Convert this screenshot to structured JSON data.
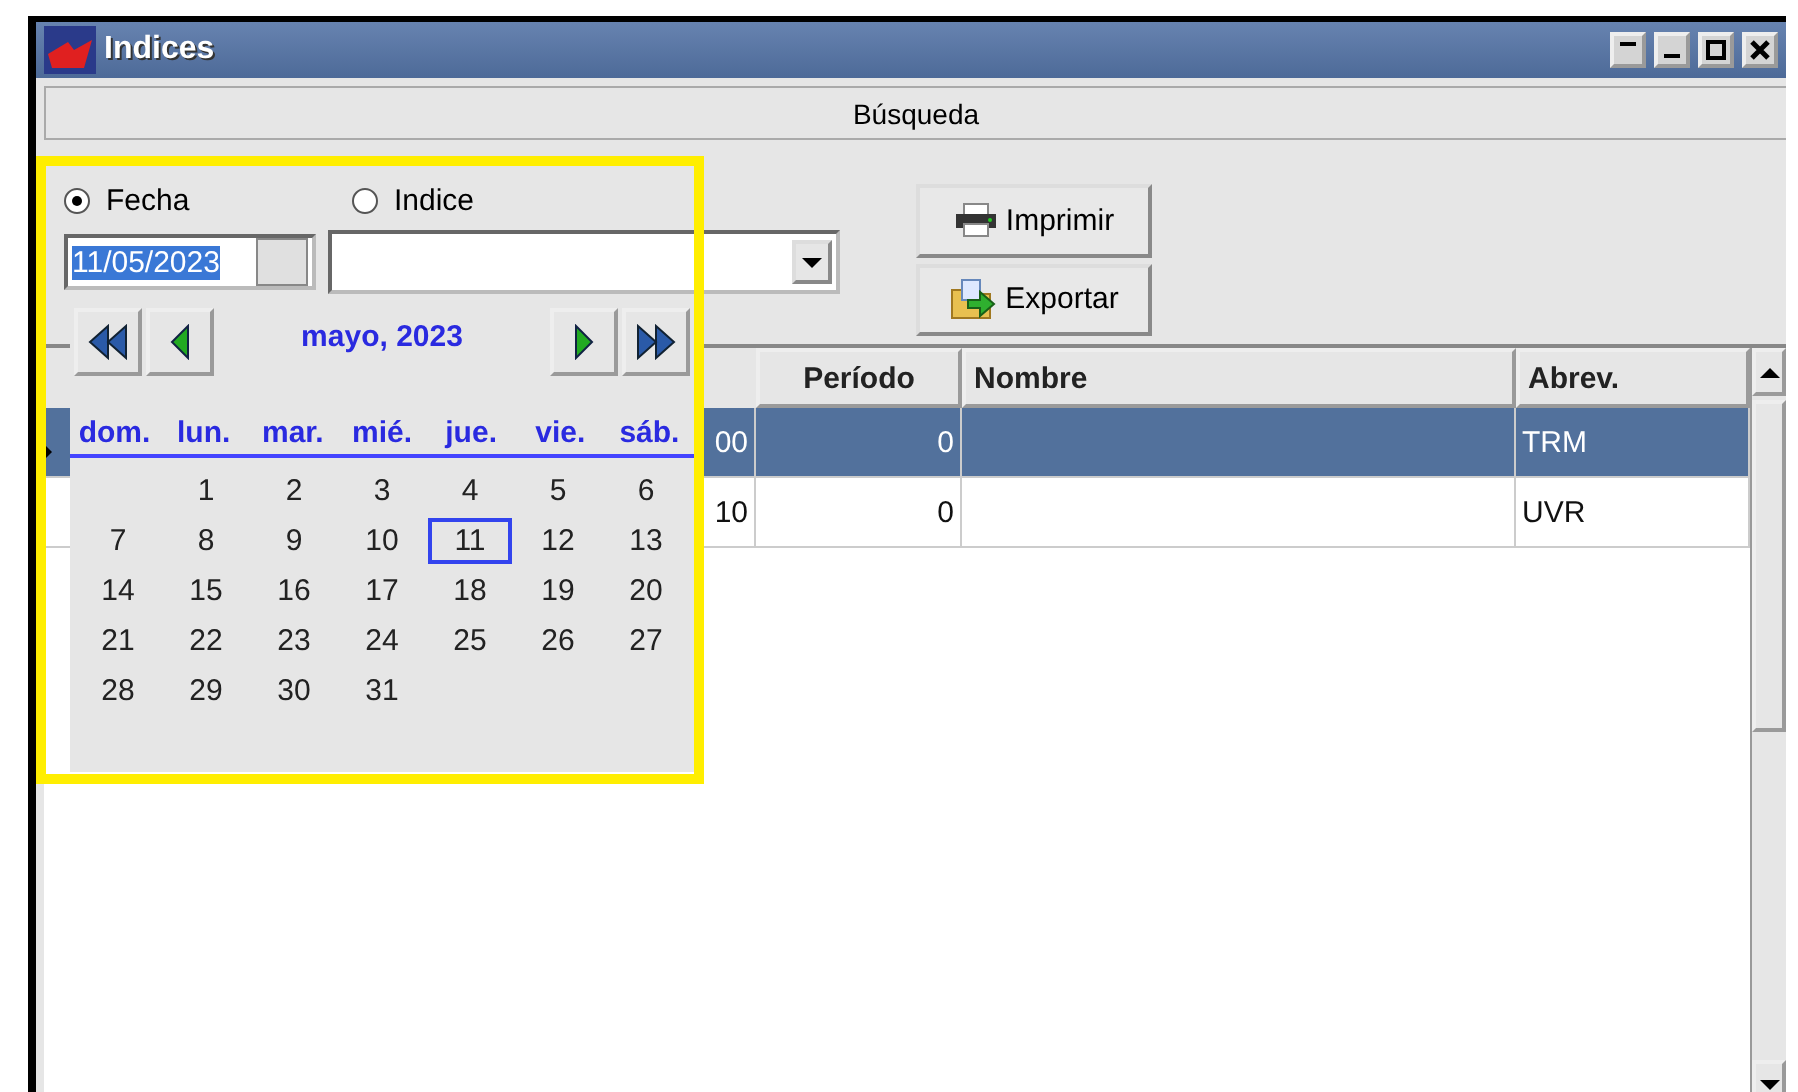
{
  "window": {
    "title": "Indices"
  },
  "section_title": "Búsqueda",
  "search_mode": [
    {
      "label": "Fecha",
      "selected": true
    },
    {
      "label": "Indice",
      "selected": false
    }
  ],
  "date_field": {
    "value": "11/05/2023"
  },
  "buttons": [
    {
      "label": "Imprimir",
      "kind": "print"
    },
    {
      "label": "Exportar",
      "kind": "export"
    }
  ],
  "table": {
    "columns": [
      "Período",
      "Nombre",
      "Abrev."
    ],
    "rows": [
      {
        "cells": [
          "00",
          "0",
          "",
          "TRM"
        ],
        "selected": true
      },
      {
        "cells": [
          "10",
          "0",
          "",
          "UVR"
        ],
        "selected": false
      }
    ]
  },
  "calendar": {
    "month": "mayo, 2023",
    "weekdays": [
      "dom.",
      "lun.",
      "mar.",
      "mié.",
      "jue.",
      "vie.",
      "sáb."
    ],
    "weeks": [
      {
        "days": [
          {
            "day": "1",
            "selected": false
          },
          {
            "day": "2",
            "selected": false
          },
          {
            "day": "3",
            "selected": false
          },
          {
            "day": "4",
            "selected": false
          },
          {
            "day": "5",
            "selected": false
          },
          {
            "day": "6",
            "selected": false
          }
        ]
      },
      {
        "days": [
          {
            "day": "7",
            "selected": false
          },
          {
            "day": "8",
            "selected": false
          },
          {
            "day": "9",
            "selected": false
          },
          {
            "day": "10",
            "selected": false
          },
          {
            "day": "11",
            "selected": true
          },
          {
            "day": "12",
            "selected": false
          },
          {
            "day": "13",
            "selected": false
          }
        ]
      },
      {
        "days": [
          {
            "day": "14",
            "selected": false
          },
          {
            "day": "15",
            "selected": false
          },
          {
            "day": "16",
            "selected": false
          },
          {
            "day": "17",
            "selected": false
          },
          {
            "day": "18",
            "selected": false
          },
          {
            "day": "19",
            "selected": false
          },
          {
            "day": "20",
            "selected": false
          }
        ]
      },
      {
        "days": [
          {
            "day": "21",
            "selected": false
          },
          {
            "day": "22",
            "selected": false
          },
          {
            "day": "23",
            "selected": false
          },
          {
            "day": "24",
            "selected": false
          },
          {
            "day": "25",
            "selected": false
          },
          {
            "day": "26",
            "selected": false
          },
          {
            "day": "27",
            "selected": false
          }
        ]
      },
      {
        "days": [
          {
            "day": "28",
            "selected": false
          },
          {
            "day": "29",
            "selected": false
          },
          {
            "day": "30",
            "selected": false
          },
          {
            "day": "31",
            "selected": false
          }
        ]
      }
    ]
  }
}
